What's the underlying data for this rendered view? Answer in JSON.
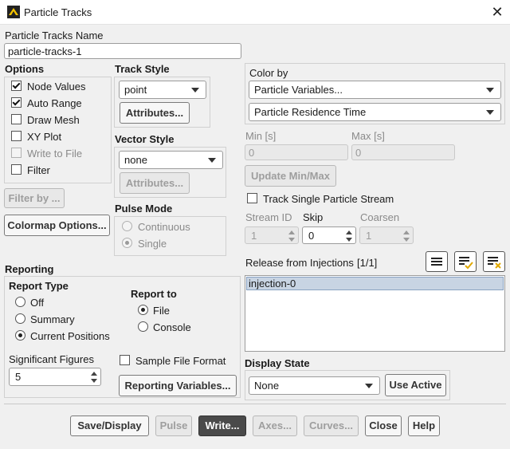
{
  "window": {
    "title": "Particle Tracks",
    "close_glyph": "✕"
  },
  "name_section": {
    "label": "Particle Tracks Name",
    "value": "particle-tracks-1"
  },
  "options": {
    "label": "Options",
    "items": [
      {
        "label": "Node Values",
        "checked": true,
        "enabled": true
      },
      {
        "label": "Auto Range",
        "checked": true,
        "enabled": true
      },
      {
        "label": "Draw Mesh",
        "checked": false,
        "enabled": true
      },
      {
        "label": "XY Plot",
        "checked": false,
        "enabled": true
      },
      {
        "label": "Write to File",
        "checked": false,
        "enabled": false
      },
      {
        "label": "Filter",
        "checked": false,
        "enabled": true
      }
    ],
    "filter_button": "Filter by ...",
    "colormap_button": "Colormap Options..."
  },
  "track_style": {
    "label": "Track Style",
    "selected": "point",
    "attributes_button": "Attributes..."
  },
  "vector_style": {
    "label": "Vector Style",
    "selected": "none",
    "attributes_button": "Attributes..."
  },
  "pulse_mode": {
    "label": "Pulse Mode",
    "options": [
      {
        "label": "Continuous",
        "selected": false
      },
      {
        "label": "Single",
        "selected": true
      }
    ]
  },
  "color_by": {
    "label": "Color by",
    "category": "Particle Variables...",
    "variable": "Particle Residence Time"
  },
  "range": {
    "min_label": "Min [s]",
    "min_value": "0",
    "max_label": "Max [s]",
    "max_value": "0",
    "update_button": "Update Min/Max"
  },
  "track_single": {
    "label": "Track Single Particle Stream",
    "checked": false
  },
  "stream": {
    "stream_id_label": "Stream ID",
    "stream_id_value": "1",
    "skip_label": "Skip",
    "skip_value": "0",
    "coarsen_label": "Coarsen",
    "coarsen_value": "1"
  },
  "injections": {
    "label": "Release from Injections",
    "count": "[1/1]",
    "items": [
      "injection-0"
    ]
  },
  "reporting": {
    "label": "Reporting",
    "report_type_label": "Report Type",
    "report_types": [
      {
        "label": "Off",
        "selected": false
      },
      {
        "label": "Summary",
        "selected": false
      },
      {
        "label": "Current Positions",
        "selected": true
      }
    ],
    "report_to_label": "Report to",
    "report_to": [
      {
        "label": "File",
        "selected": true
      },
      {
        "label": "Console",
        "selected": false
      }
    ],
    "sig_figs_label": "Significant Figures",
    "sig_figs_value": "5",
    "sample_format_label": "Sample File Format",
    "reporting_vars_button": "Reporting Variables..."
  },
  "display_state": {
    "label": "Display State",
    "selected": "None",
    "use_active_button": "Use Active"
  },
  "footer": {
    "save_display": "Save/Display",
    "pulse": "Pulse",
    "write": "Write...",
    "axes": "Axes...",
    "curves": "Curves...",
    "close": "Close",
    "help": "Help"
  }
}
